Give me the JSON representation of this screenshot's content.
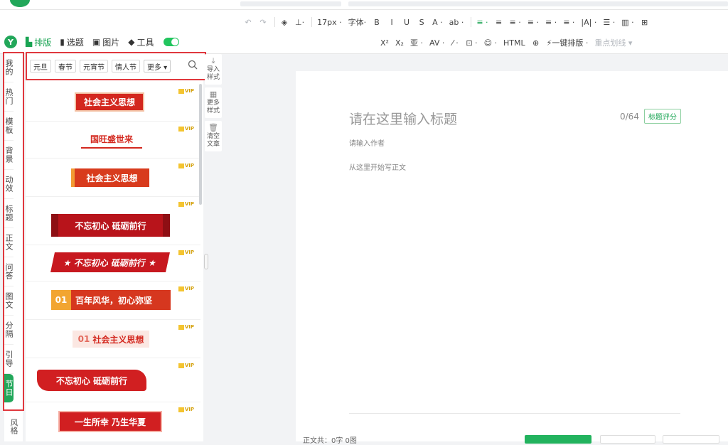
{
  "toolbar": {
    "row1": [
      "↶",
      "↷",
      "◈",
      "⊥·",
      "17px ·",
      "字体·",
      "B",
      "I",
      "U",
      "S",
      "A ·",
      "ab ·",
      "≡ ·",
      "≡",
      "≡ ·",
      "≡ ·",
      "≡ ·",
      "≡ ·",
      "|A| ·",
      "☰ ·",
      "▥ ·",
      "⊞"
    ],
    "row2": [
      "X²",
      "X₂",
      "亚 ·",
      "AV ·",
      "⁄ ·",
      "⊡ ·",
      "☺ ·",
      "HTML",
      "⊕",
      "⚡一键排版 ·",
      "重点划线 ▾"
    ]
  },
  "nav": {
    "brand": "Y",
    "tabs": [
      {
        "icon": "▙",
        "label": "排版",
        "active": true
      },
      {
        "icon": "▮",
        "label": "选题",
        "active": false
      },
      {
        "icon": "▣",
        "label": "图片",
        "active": false
      },
      {
        "icon": "◆",
        "label": "工具",
        "active": false
      }
    ]
  },
  "categories": [
    {
      "label": "我的",
      "active": false
    },
    {
      "label": "热门",
      "active": false
    },
    {
      "label": "模板",
      "active": false
    },
    {
      "label": "背景",
      "active": false
    },
    {
      "label": "动效",
      "active": false
    },
    {
      "label": "标题",
      "active": false
    },
    {
      "label": "正文",
      "active": false
    },
    {
      "label": "问答",
      "active": false
    },
    {
      "label": "图文",
      "active": false
    },
    {
      "label": "分隔",
      "active": false
    },
    {
      "label": "引导",
      "active": false
    },
    {
      "label": "节日",
      "active": true
    }
  ],
  "category_below": "风格",
  "tags": [
    "元旦",
    "春节",
    "元宵节",
    "情人节"
  ],
  "tag_more": "更多 ▾",
  "templates": [
    {
      "text": "社会主义思想",
      "vip": "VIP"
    },
    {
      "text": "国旺盛世来",
      "vip": "VIP"
    },
    {
      "text": "社会主义思想",
      "vip": "VIP"
    },
    {
      "text": "不忘初心 砥砺前行",
      "vip": "VIP"
    },
    {
      "text": "★ 不忘初心 砥砺前行 ★",
      "vip": "VIP"
    },
    {
      "num": "01",
      "text": "百年风华，初心弥坚",
      "vip": "VIP"
    },
    {
      "num": "01",
      "text": "社会主义思想",
      "vip": "VIP"
    },
    {
      "text": "不忘初心 砥砺前行",
      "vip": "VIP"
    },
    {
      "text": "一生所幸 乃生华夏",
      "vip": "VIP"
    }
  ],
  "side_tools": [
    {
      "icon": "⤓",
      "label": "导入样式"
    },
    {
      "icon": "▦",
      "label": "更多样式"
    },
    {
      "icon": "🗑",
      "label": "清空文章"
    }
  ],
  "editor": {
    "title_placeholder": "请在这里输入标题",
    "count": "0/64",
    "score_button": "标题评分",
    "author_placeholder": "请输入作者",
    "body_placeholder": "从这里开始写正文"
  },
  "bottom": {
    "word_count": "正文共：0字 0图"
  },
  "colors": {
    "accent": "#22a75a",
    "highlight": "#e0383e"
  }
}
